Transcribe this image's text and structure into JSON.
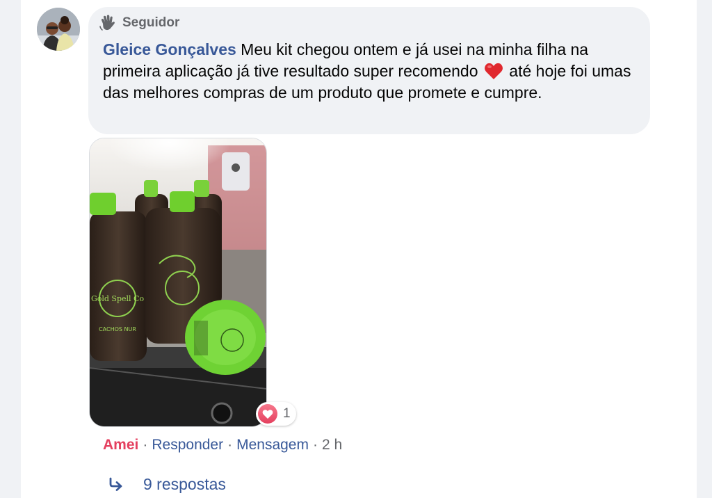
{
  "comment": {
    "badge": "Seguidor",
    "author": "Gleice Gonçalves",
    "text_before": "Meu kit chegou ontem e já usei na minha filha na primeira aplicação já tive resultado super recomendo",
    "text_after": "até hoje foi umas das melhores compras de um produto que promete e cumpre.",
    "emoji": "red-heart"
  },
  "photo": {
    "label_brand": "Gold Spell Co",
    "label_product": "CACHOS NUR"
  },
  "reaction": {
    "icon": "love-heart",
    "count": "1"
  },
  "actions": {
    "like": "Amei",
    "separator": "·",
    "reply": "Responder",
    "message": "Mensagem",
    "time": "2 h"
  },
  "replies": {
    "label": "9 respostas"
  },
  "colors": {
    "link": "#385898",
    "love": "#e4405f",
    "bubble": "#f0f2f5",
    "muted": "#65676b"
  }
}
